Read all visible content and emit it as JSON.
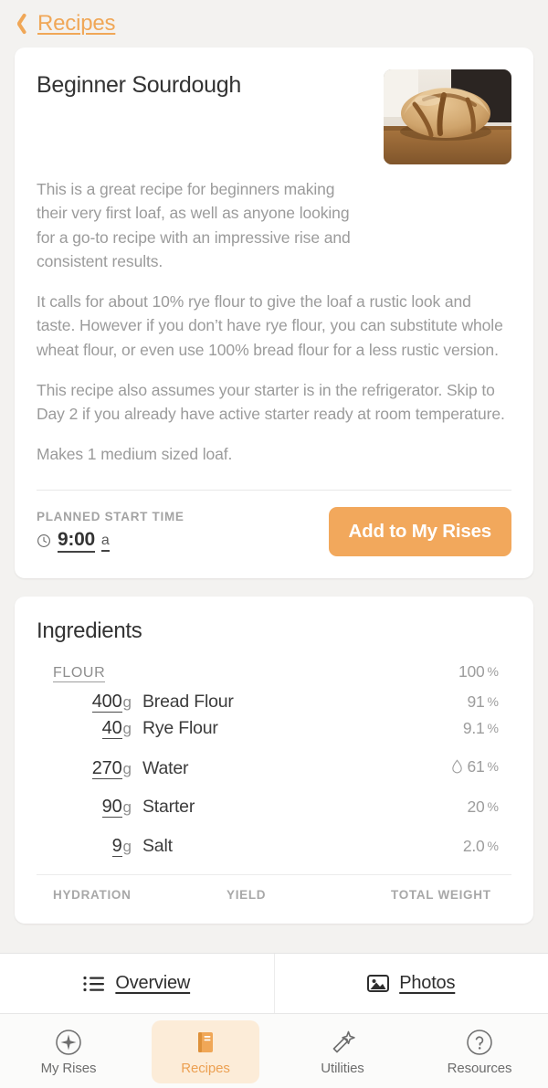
{
  "nav": {
    "back_label": "Recipes",
    "back_icon": "chevron-left-icon"
  },
  "recipe": {
    "title": "Beginner Sourdough",
    "photo_alt": "sourdough-loaf-photo",
    "description": [
      "This is a great recipe for beginners making their very first loaf, as well as anyone looking for a go-to recipe with an impressive rise and consistent results.",
      "It calls for about 10% rye flour to give the loaf a rustic look and taste. However if you don’t have rye flour, you can substitute whole wheat flour, or even use 100% bread flour for a less rustic version.",
      "This recipe also assumes your starter is in the refrigerator. Skip to Day 2 if you already have active starter ready at room temperature.",
      "Makes 1 medium sized loaf."
    ],
    "planned_start": {
      "label": "PLANNED START TIME",
      "icon": "clock-icon",
      "time": "9:00",
      "suffix": "a"
    },
    "cta_label": "Add to My Rises"
  },
  "ingredients": {
    "section_title": "Ingredients",
    "flour_group": {
      "label": "FLOUR",
      "percent": "100",
      "percent_sign": "%",
      "items": [
        {
          "amount": "400",
          "unit": "g",
          "name": "Bread Flour",
          "percent": "91",
          "percent_sign": "%",
          "icon": null
        },
        {
          "amount": "40",
          "unit": "g",
          "name": "Rye Flour",
          "percent": "9.1",
          "percent_sign": "%",
          "icon": null
        }
      ]
    },
    "other_items": [
      {
        "amount": "270",
        "unit": "g",
        "name": "Water",
        "percent": "61",
        "percent_sign": "%",
        "icon": "water-drop-icon"
      },
      {
        "amount": "90",
        "unit": "g",
        "name": "Starter",
        "percent": "20",
        "percent_sign": "%",
        "icon": null
      },
      {
        "amount": "9",
        "unit": "g",
        "name": "Salt",
        "percent": "2.0",
        "percent_sign": "%",
        "icon": null
      }
    ],
    "stats_headers": [
      "HYDRATION",
      "YIELD",
      "TOTAL WEIGHT"
    ]
  },
  "segmented": [
    {
      "label": "Overview",
      "icon": "list-icon",
      "selected": true
    },
    {
      "label": "Photos",
      "icon": "photo-icon",
      "selected": false
    }
  ],
  "tabs": [
    {
      "label": "My Rises",
      "icon": "sparkle-circle-icon",
      "active": false
    },
    {
      "label": "Recipes",
      "icon": "book-icon",
      "active": true
    },
    {
      "label": "Utilities",
      "icon": "magic-wand-icon",
      "active": false
    },
    {
      "label": "Resources",
      "icon": "question-circle-icon",
      "active": false
    }
  ],
  "colors": {
    "accent": "#f2a85c",
    "accent_soft": "#fcecd8",
    "page_bg": "#f3f2f0",
    "card_bg": "#ffffff",
    "muted_text": "#9b9b9b"
  }
}
